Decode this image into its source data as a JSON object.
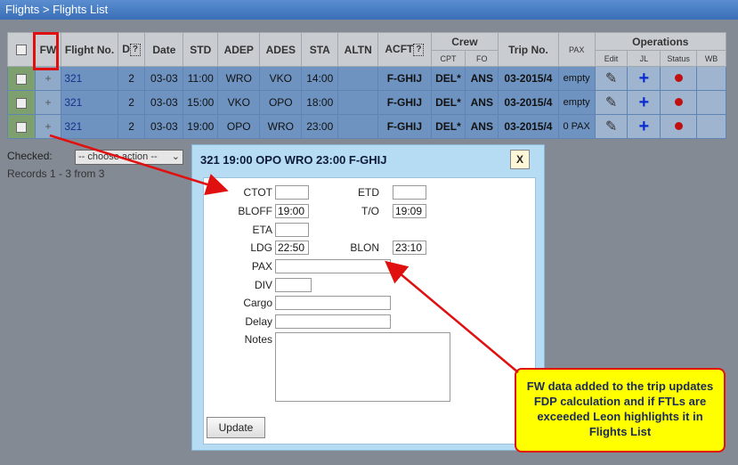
{
  "breadcrumb": "Flights > Flights List",
  "table": {
    "headers": {
      "fw": "FW",
      "flight_no": "Flight No.",
      "d": "D",
      "date": "Date",
      "std": "STD",
      "adep": "ADEP",
      "ades": "ADES",
      "sta": "STA",
      "altn": "ALTN",
      "acft": "ACFT",
      "crew": "Crew",
      "trip_no": "Trip No.",
      "pax": "PAX",
      "operations": "Operations",
      "cpt": "CPT",
      "fo": "FO",
      "edit": "Edit",
      "jl": "JL",
      "status": "Status",
      "wb": "WB",
      "help": "?"
    },
    "rows": [
      {
        "fw": "+",
        "flight_no": "321",
        "d": "2",
        "date": "03-03",
        "std": "11:00",
        "adep": "WRO",
        "ades": "VKO",
        "sta": "14:00",
        "altn": "",
        "acft": "F-GHIJ",
        "cpt": "DEL*",
        "fo": "ANS",
        "trip_no": "03-2015/4",
        "pax": "empty"
      },
      {
        "fw": "+",
        "flight_no": "321",
        "d": "2",
        "date": "03-03",
        "std": "15:00",
        "adep": "VKO",
        "ades": "OPO",
        "sta": "18:00",
        "altn": "",
        "acft": "F-GHIJ",
        "cpt": "DEL*",
        "fo": "ANS",
        "trip_no": "03-2015/4",
        "pax": "empty"
      },
      {
        "fw": "+",
        "flight_no": "321",
        "d": "2",
        "date": "03-03",
        "std": "19:00",
        "adep": "OPO",
        "ades": "WRO",
        "sta": "23:00",
        "altn": "",
        "acft": "F-GHIJ",
        "cpt": "DEL*",
        "fo": "ANS",
        "trip_no": "03-2015/4",
        "pax": "0 PAX"
      }
    ]
  },
  "checked_label": "Checked:",
  "action_select": {
    "value": "-- choose action --"
  },
  "records": "Records 1 - 3 from 3",
  "dialog": {
    "title": "321 19:00 OPO WRO 23:00 F-GHIJ",
    "close": "X",
    "fields": {
      "ctot": {
        "label": "CTOT",
        "value": ""
      },
      "etd": {
        "label": "ETD",
        "value": ""
      },
      "bloff": {
        "label": "BLOFF",
        "value": "19:00"
      },
      "to": {
        "label": "T/O",
        "value": "19:09"
      },
      "eta": {
        "label": "ETA",
        "value": ""
      },
      "ldg": {
        "label": "LDG",
        "value": "22:50"
      },
      "blon": {
        "label": "BLON",
        "value": "23:10"
      },
      "pax": {
        "label": "PAX",
        "value": ""
      },
      "div": {
        "label": "DIV",
        "value": ""
      },
      "cargo": {
        "label": "Cargo",
        "value": ""
      },
      "delay": {
        "label": "Delay",
        "value": ""
      },
      "notes": {
        "label": "Notes",
        "value": ""
      }
    },
    "update": "Update"
  },
  "callout": "FW data added to the trip updates FDP calculation and if FTLs are exceeded Leon highlights it in Flights List",
  "colors": {
    "highlight": "#e01010",
    "callout_bg": "#ffff00",
    "row_bg": "#6e93c0"
  }
}
